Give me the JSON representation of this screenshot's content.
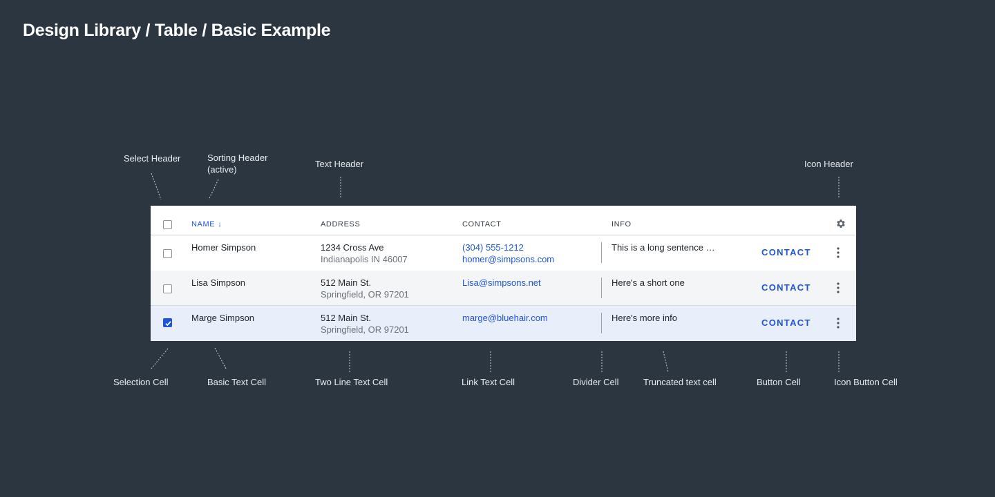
{
  "page": {
    "title": "Design Library / Table / Basic Example"
  },
  "annotations": {
    "select_header": "Select Header",
    "sorting_header_line1": "Sorting Header",
    "sorting_header_line2": "(active)",
    "text_header": "Text Header",
    "icon_header": "Icon Header",
    "selection_cell": "Selection Cell",
    "basic_text_cell": "Basic Text Cell",
    "two_line_text_cell": "Two Line Text Cell",
    "link_text_cell": "Link Text Cell",
    "divider_cell": "Divider Cell",
    "truncated_text_cell": "Truncated text cell",
    "button_cell": "Button Cell",
    "icon_button_cell": "Icon Button Cell"
  },
  "table": {
    "headers": {
      "name": "NAME",
      "name_sort_icon": "arrow-down-icon",
      "address": "ADDRESS",
      "contact": "CONTACT",
      "info": "INFO",
      "settings_icon": "gear-icon"
    },
    "rows": [
      {
        "selected": false,
        "name": "Homer Simpson",
        "address_line1": "1234 Cross Ave",
        "address_line2": "Indianapolis IN 46007",
        "contact_line1": "(304) 555-1212",
        "contact_line2": "homer@simpsons.com",
        "info": "This is a long sentence …",
        "button": "CONTACT",
        "menu_icon": "kebab-menu-icon"
      },
      {
        "selected": false,
        "name": "Lisa Simpson",
        "address_line1": "512 Main St.",
        "address_line2": "Springfield, OR 97201",
        "contact_line1": "Lisa@simpsons.net",
        "contact_line2": "",
        "info": "Here's a short one",
        "button": "CONTACT",
        "menu_icon": "kebab-menu-icon"
      },
      {
        "selected": true,
        "name": "Marge Simpson",
        "address_line1": "512 Main St.",
        "address_line2": "Springfield, OR 97201",
        "contact_line1": "marge@bluehair.com",
        "contact_line2": "",
        "info": "Here's more info",
        "button": "CONTACT",
        "menu_icon": "kebab-menu-icon"
      }
    ]
  },
  "colors": {
    "background": "#2c3640",
    "accent": "#1f55d6",
    "selected_row": "#e8eefa"
  }
}
